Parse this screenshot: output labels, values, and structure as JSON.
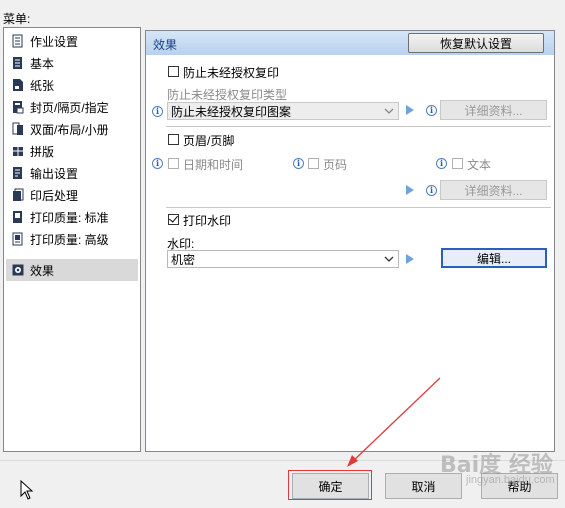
{
  "menu": {
    "label": "菜单:",
    "items": [
      {
        "label": "作业设置",
        "icon": "job-settings-icon"
      },
      {
        "label": "基本",
        "icon": "basic-icon"
      },
      {
        "label": "纸张",
        "icon": "paper-icon"
      },
      {
        "label": "封页/隔页/指定",
        "icon": "cover-page-icon"
      },
      {
        "label": "双面/布局/小册",
        "icon": "duplex-layout-icon"
      },
      {
        "label": "拼版",
        "icon": "imposition-icon"
      },
      {
        "label": "输出设置",
        "icon": "output-settings-icon"
      },
      {
        "label": "印后处理",
        "icon": "finishing-icon"
      },
      {
        "label": "打印质量: 标准",
        "icon": "quality-standard-icon"
      },
      {
        "label": "打印质量: 高级",
        "icon": "quality-advanced-icon"
      },
      {
        "label": "效果",
        "icon": "effects-icon"
      }
    ],
    "selected": "效果"
  },
  "pane": {
    "title": "效果",
    "restore_defaults": "恢复默认设置"
  },
  "copy_protect": {
    "checkbox_label": "防止未经授权复印",
    "checked": false,
    "type_label": "防止未经授权复印类型",
    "type_value": "防止未经授权复印图案",
    "details_button": "详细资料..."
  },
  "header_footer": {
    "checkbox_label": "页眉/页脚",
    "checked": false,
    "date_time_label": "日期和时间",
    "page_number_label": "页码",
    "text_label": "文本",
    "details_button": "详细资料..."
  },
  "watermark": {
    "checkbox_label": "打印水印",
    "checked": true,
    "field_label": "水印:",
    "value": "机密",
    "edit_button": "编辑..."
  },
  "footer": {
    "ok": "确定",
    "cancel": "取消",
    "help": "帮助"
  },
  "colors": {
    "header_gradient_top": "#d6e6f7",
    "header_gradient_bottom": "#b8d1ee",
    "title_text": "#1c3f8a",
    "annotation_red": "#e03a3a",
    "play_icon": "#6fa4d8"
  },
  "overlay_watermark": {
    "text": "Bai度 经验",
    "sub": "jingyan.baidu.com"
  }
}
